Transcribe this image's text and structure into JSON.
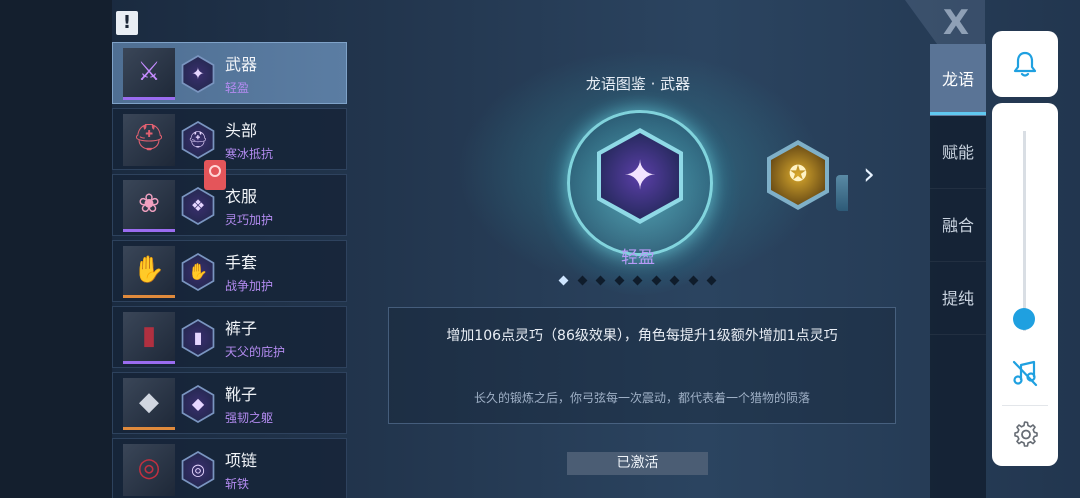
{
  "alert_glyph": "!",
  "close_glyph": "X",
  "equipment": [
    {
      "name": "武器",
      "sub": "轻盈",
      "icon": "weapon-icon",
      "glyph": "✦",
      "rarity": "#9a6cf0"
    },
    {
      "name": "头部",
      "sub": "寒冰抵抗",
      "icon": "helmet-icon",
      "glyph": "⛑",
      "rarity": "#9a6cf0"
    },
    {
      "name": "衣服",
      "sub": "灵巧加护",
      "icon": "armor-icon",
      "glyph": "❖",
      "rarity": "#9a6cf0"
    },
    {
      "name": "手套",
      "sub": "战争加护",
      "icon": "gloves-icon",
      "glyph": "✋",
      "rarity": "#e08a3c"
    },
    {
      "name": "裤子",
      "sub": "天父的庇护",
      "icon": "pants-icon",
      "glyph": "▮",
      "rarity": "#9a6cf0"
    },
    {
      "name": "靴子",
      "sub": "强韧之躯",
      "icon": "boots-icon",
      "glyph": "◆",
      "rarity": "#e08a3c"
    },
    {
      "name": "项链",
      "sub": "斩铁",
      "icon": "necklace-icon",
      "glyph": "◎",
      "rarity": "#9a6cf0"
    }
  ],
  "codex": {
    "title": "龙语图鉴 · 武器",
    "emblem_name": "轻盈",
    "emblem_glyph": "✦",
    "next_emblem_glyph": "✪",
    "next_arrow": "›",
    "page_count": 9,
    "active_page": 1,
    "description": "增加106点灵巧（86级效果），角色每提升1级额外增加1点灵巧",
    "flavor": "长久的锻炼之后，你弓弦每一次震动，都代表着一个猎物的陨落",
    "status": "已激活"
  },
  "tabs": [
    {
      "label": "龙语",
      "active": true
    },
    {
      "label": "赋能",
      "active": false
    },
    {
      "label": "融合",
      "active": false
    },
    {
      "label": "提纯",
      "active": false
    }
  ],
  "system_panel": {
    "volume_level": 0.06,
    "accent": "#1fa0e0"
  }
}
